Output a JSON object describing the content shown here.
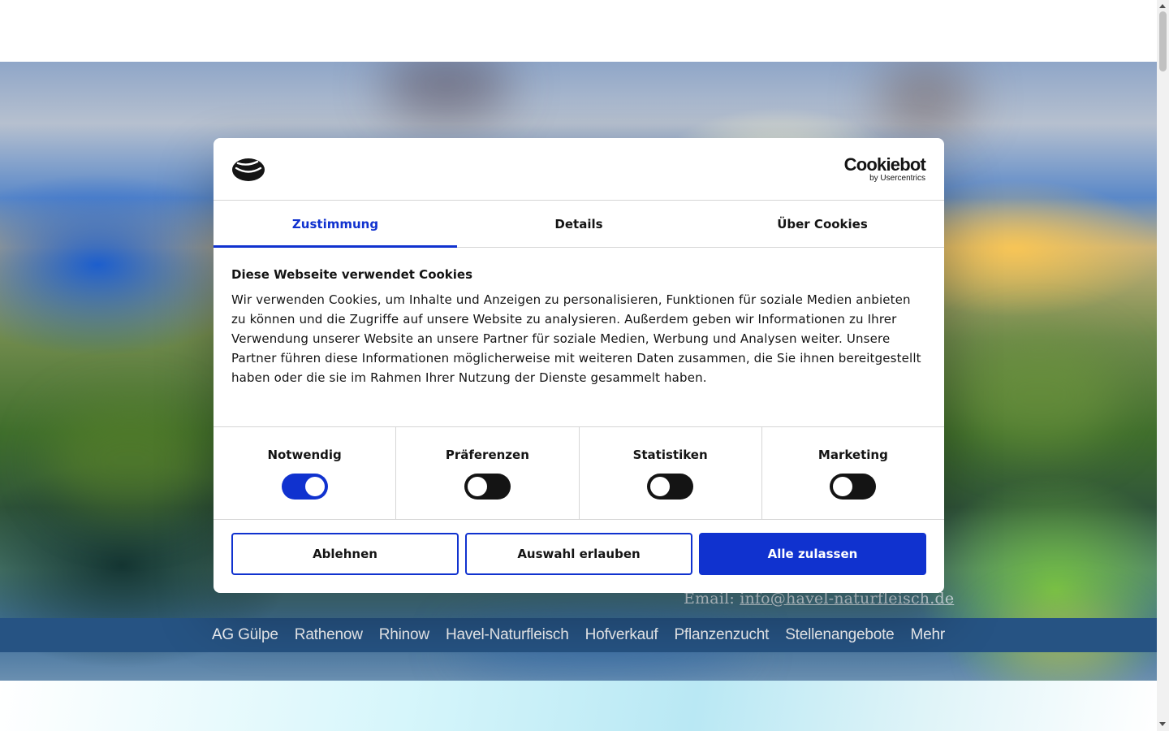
{
  "dialog": {
    "brand": {
      "name": "Cookiebot",
      "sub": "by Usercentrics"
    },
    "tabs": [
      {
        "label": "Zustimmung",
        "active": true
      },
      {
        "label": "Details",
        "active": false
      },
      {
        "label": "Über Cookies",
        "active": false
      }
    ],
    "title": "Diese Webseite verwendet Cookies",
    "text": "Wir verwenden Cookies, um Inhalte und Anzeigen zu personalisieren, Funktionen für soziale Medien anbieten zu können und die Zugriffe auf unsere Website zu analysieren. Außerdem geben wir Informationen zu Ihrer Verwendung unserer Website an unsere Partner für soziale Medien, Werbung und Analysen weiter. Unsere Partner führen diese Informationen möglicherweise mit weiteren Daten zusammen, die Sie ihnen bereitgestellt haben oder die sie im Rahmen Ihrer Nutzung der Dienste gesammelt haben.",
    "toggles": [
      {
        "label": "Notwendig",
        "checked": true
      },
      {
        "label": "Präferenzen",
        "checked": false
      },
      {
        "label": "Statistiken",
        "checked": false
      },
      {
        "label": "Marketing",
        "checked": false
      }
    ],
    "buttons": {
      "decline": "Ablehnen",
      "allow_selection": "Auswahl erlauben",
      "allow_all": "Alle zulassen"
    },
    "colors": {
      "accent": "#1032cf",
      "text": "#141414"
    }
  },
  "hero": {
    "email_prefix": "Email:",
    "email_link": "info@havel-naturfleisch.de"
  },
  "nav": {
    "items": [
      "AG Gülpe",
      "Rathenow",
      "Rhinow",
      "Havel-Naturfleisch",
      "Hofverkauf",
      "Pflanzenzucht",
      "Stellenangebote",
      "Mehr"
    ],
    "background": "#265383"
  }
}
